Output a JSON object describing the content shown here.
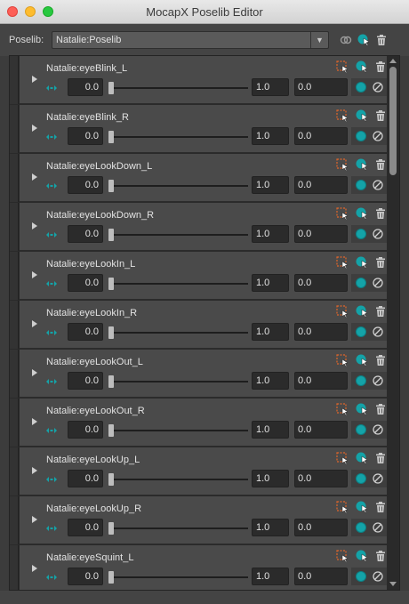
{
  "window": {
    "title": "MocapX Poselib Editor"
  },
  "poselib": {
    "label": "Poselib:",
    "selected": "Natalie:Poselib",
    "dropdown_icon": "chevron-down-icon",
    "actions": [
      "link-icon",
      "pick-pose-icon",
      "trash-icon"
    ]
  },
  "pose_row_icons": [
    "select-controls-icon",
    "update-pose-icon",
    "delete-icon"
  ],
  "colors": {
    "accent_teal": "#14a3a8",
    "select_icon_orange": "#e0662a"
  },
  "poses": [
    {
      "name": "Natalie:eyeBlink_L",
      "min": "0.0",
      "max": "1.0",
      "value": "0.0",
      "slider": 0.0
    },
    {
      "name": "Natalie:eyeBlink_R",
      "min": "0.0",
      "max": "1.0",
      "value": "0.0",
      "slider": 0.0
    },
    {
      "name": "Natalie:eyeLookDown_L",
      "min": "0.0",
      "max": "1.0",
      "value": "0.0",
      "slider": 0.0
    },
    {
      "name": "Natalie:eyeLookDown_R",
      "min": "0.0",
      "max": "1.0",
      "value": "0.0",
      "slider": 0.0
    },
    {
      "name": "Natalie:eyeLookIn_L",
      "min": "0.0",
      "max": "1.0",
      "value": "0.0",
      "slider": 0.0
    },
    {
      "name": "Natalie:eyeLookIn_R",
      "min": "0.0",
      "max": "1.0",
      "value": "0.0",
      "slider": 0.0
    },
    {
      "name": "Natalie:eyeLookOut_L",
      "min": "0.0",
      "max": "1.0",
      "value": "0.0",
      "slider": 0.0
    },
    {
      "name": "Natalie:eyeLookOut_R",
      "min": "0.0",
      "max": "1.0",
      "value": "0.0",
      "slider": 0.0
    },
    {
      "name": "Natalie:eyeLookUp_L",
      "min": "0.0",
      "max": "1.0",
      "value": "0.0",
      "slider": 0.0
    },
    {
      "name": "Natalie:eyeLookUp_R",
      "min": "0.0",
      "max": "1.0",
      "value": "0.0",
      "slider": 0.0
    },
    {
      "name": "Natalie:eyeSquint_L",
      "min": "0.0",
      "max": "1.0",
      "value": "0.0",
      "slider": 0.0
    }
  ]
}
